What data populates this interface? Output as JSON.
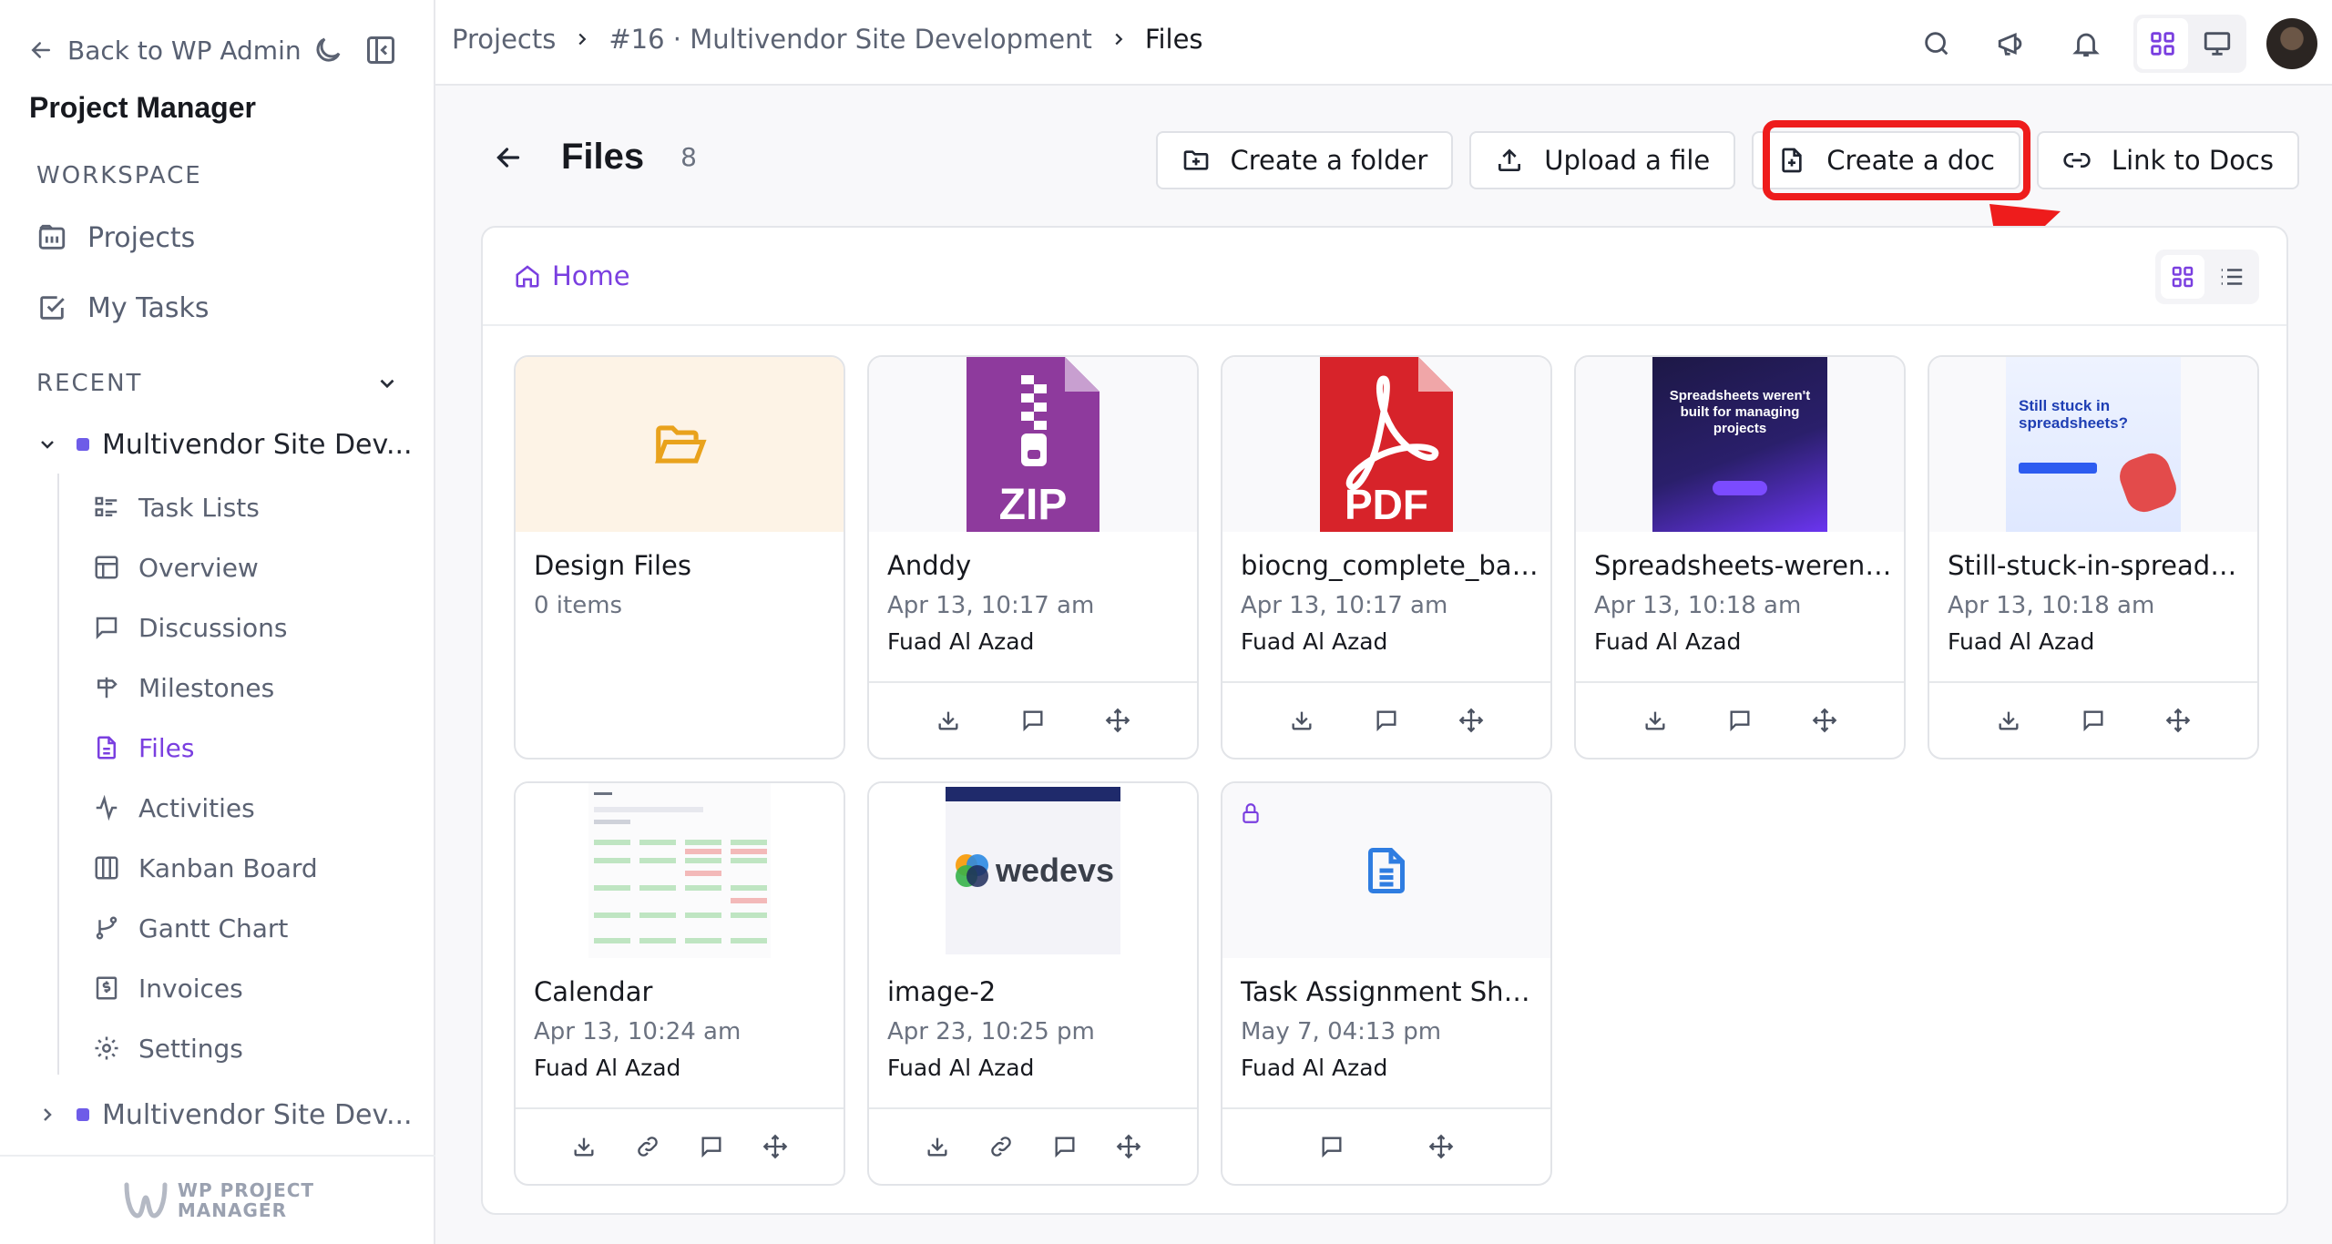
{
  "sidebar": {
    "back_label": "Back to WP Admin",
    "title": "Project Manager",
    "workspace_label": "WORKSPACE",
    "workspace_items": [
      {
        "label": "Projects"
      },
      {
        "label": "My Tasks"
      }
    ],
    "recent_label": "RECENT",
    "recent_projects": [
      {
        "label": "Multivendor Site Dev...",
        "expanded": true
      },
      {
        "label": "Multivendor Site Dev...",
        "expanded": false
      }
    ],
    "project_nav": [
      {
        "label": "Task Lists"
      },
      {
        "label": "Overview"
      },
      {
        "label": "Discussions"
      },
      {
        "label": "Milestones"
      },
      {
        "label": "Files",
        "active": true
      },
      {
        "label": "Activities"
      },
      {
        "label": "Kanban Board"
      },
      {
        "label": "Gantt Chart"
      },
      {
        "label": "Invoices"
      },
      {
        "label": "Settings"
      }
    ],
    "footer_logo_lines": [
      "WP PROJECT",
      "MANAGER"
    ]
  },
  "breadcrumb": {
    "items": [
      "Projects",
      "#16 · Multivendor Site Development"
    ],
    "current": "Files"
  },
  "page": {
    "title": "Files",
    "count": "8"
  },
  "actions": {
    "create_folder": "Create a folder",
    "upload_file": "Upload a file",
    "create_doc": "Create a doc",
    "link_docs": "Link to Docs"
  },
  "browser": {
    "home_label": "Home"
  },
  "files": [
    {
      "name": "Design Files",
      "meta": "0 items",
      "owner": ""
    },
    {
      "name": "Anddy",
      "meta": "Apr 13, 10:17 am",
      "owner": "Fuad Al Azad",
      "thumb_text": "ZIP"
    },
    {
      "name": "biocng_complete_ban...",
      "meta": "Apr 13, 10:17 am",
      "owner": "Fuad Al Azad",
      "thumb_text": "PDF"
    },
    {
      "name": "Spreadsheets-werent...",
      "meta": "Apr 13, 10:18 am",
      "owner": "Fuad Al Azad",
      "thumb_text": "Spreadsheets weren't built for managing projects"
    },
    {
      "name": "Still-stuck-in-spreads...",
      "meta": "Apr 13, 10:18 am",
      "owner": "Fuad Al Azad",
      "thumb_text": "Still stuck in spreadsheets?"
    },
    {
      "name": "Calendar",
      "meta": "Apr 13, 10:24 am",
      "owner": "Fuad Al Azad"
    },
    {
      "name": "image-2",
      "meta": "Apr 23, 10:25 pm",
      "owner": "Fuad Al Azad",
      "thumb_text": "wedevs"
    },
    {
      "name": "Task Assignment Sheet",
      "meta": "May 7, 04:13 pm",
      "owner": "Fuad Al Azad"
    }
  ],
  "colors": {
    "accent": "#7a3fe0",
    "highlight": "#ee1c1c",
    "project_dot": "#6e5ce8"
  }
}
